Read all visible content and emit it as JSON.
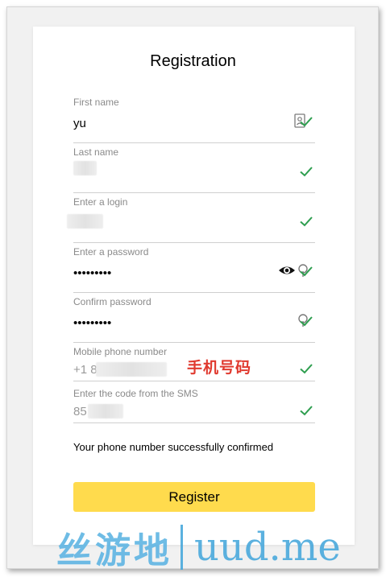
{
  "form": {
    "title": "Registration",
    "fields": [
      {
        "label": "First name",
        "value": "yu"
      },
      {
        "label": "Last name",
        "value": ""
      },
      {
        "label": "Enter a login",
        "value": ""
      },
      {
        "label": "Enter a password",
        "value": "•••••••••"
      },
      {
        "label": "Confirm password",
        "value": "•••••••••"
      },
      {
        "label": "Mobile phone number",
        "value": "+1 8"
      },
      {
        "label": "Enter the code from the SMS",
        "value": "85"
      }
    ],
    "phone_annotation": "手机号码",
    "confirm_message": "Your phone number successfully confirmed",
    "register_label": "Register"
  },
  "watermark": {
    "chinese": "丝游地",
    "domain": "uud.me"
  },
  "colors": {
    "accent_button": "#ffdb4d",
    "check_green": "#2e9e4f",
    "annotation_red": "#e03a2f",
    "watermark_blue": "#4aa9dc"
  },
  "icons": {
    "valid": "check-icon",
    "show_password": "eye-icon",
    "autofill": "autofill-key-icon"
  }
}
